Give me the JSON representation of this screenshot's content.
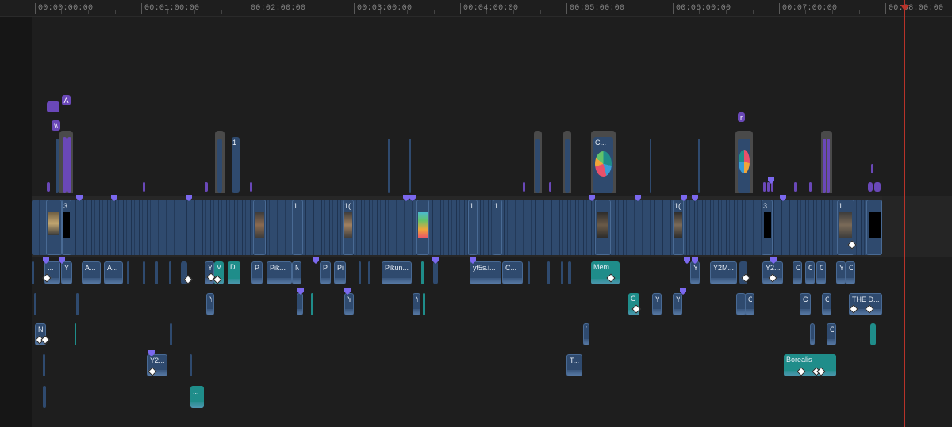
{
  "ruler": {
    "labels": [
      "00:00:00:00",
      "00:01:00:00",
      "00:02:00:00",
      "00:03:00:00",
      "00:04:00:00",
      "00:05:00:00",
      "00:06:00:00",
      "00:07:00:00",
      "00:08:00:00"
    ]
  },
  "colors": {
    "video_clip": "#2f4a6e",
    "teal_clip": "#1f8d8a",
    "purple_clip": "#6a48b8",
    "playhead": "#b8332a"
  },
  "tags": {
    "a": "A",
    "dots": "...",
    "w": "\\\\",
    "r": "r"
  },
  "clips": {
    "v_3": "3",
    "v_1a": "1",
    "v_1b": "1",
    "v_1c": "1(",
    "v_1d": "1",
    "v_1e": "1",
    "v_dots1": "...",
    "v_1f": "1(",
    "v_3b": "3",
    "v_1g": "1...",
    "top_1": "1",
    "top_c": "C...",
    "a1_dots": "...",
    "a1_y": "Y",
    "a1_a1": "A...",
    "a1_a2": "A...",
    "a1_y2": "Y",
    "a1_v": "V",
    "a1_d": "D",
    "a1_p": "P",
    "a1_pik": "Pik...",
    "a1_n": "N",
    "a1_p2": "P",
    "a1_pi": "Pi",
    "a1_pikun": "Pikun...",
    "a1_yt5s": "yt5s.i...",
    "a1_c": "C...",
    "a1_mem": "Mem...",
    "a1_y3": "Y",
    "a1_y2m": "Y2M...",
    "a1_y2b": "Y2...",
    "a1_c1": "C",
    "a1_c2": "C",
    "a1_c3": "C",
    "a1_y4": "Y",
    "a1_c4": "C",
    "a2_y": "Y",
    "a2_y2": "Y",
    "a2_y3": "Y",
    "a2_c": "C",
    "a2_y4": "Y",
    "a2_y5": "Y",
    "a2_c2": "C",
    "a2_c3": "C",
    "a2_c4": "C",
    "a2_thed": "THE D...",
    "a3_n": "N",
    "a3_y": "Y",
    "a3_c": "C",
    "a4_y2": "Y2...",
    "a4_t": "T...",
    "a4_borealis": "Borealis",
    "a5_dots": "..."
  }
}
